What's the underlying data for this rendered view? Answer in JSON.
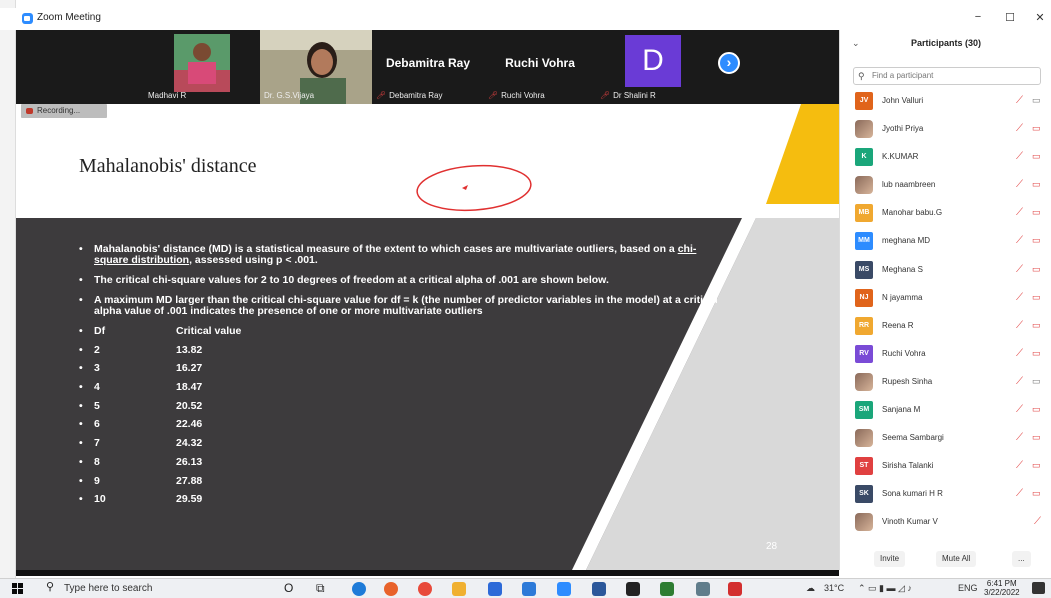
{
  "window": {
    "title": "Zoom Meeting",
    "minimize": "−",
    "maximize": "☐",
    "close": "✕"
  },
  "video_strip": {
    "tiles": [
      {
        "name": "Madhavi R"
      },
      {
        "name": "Dr. G.S.Vijaya"
      },
      {
        "big_name": "Debamitra Ray",
        "name": "Debamitra Ray"
      },
      {
        "big_name": "Ruchi Vohra",
        "name": "Ruchi Vohra"
      },
      {
        "letter": "D",
        "name": "Dr Shalini R"
      }
    ],
    "next_arrow": "›"
  },
  "recording": {
    "label": "Recording..."
  },
  "slide": {
    "title": "Mahalanobis' distance",
    "bullet1_pre": "Mahalanobis' distance (MD) is a statistical measure of the extent to which cases are multivariate outliers, based on a ",
    "bullet1_link": "chi-square distribution",
    "bullet1_post": ", assessed using p < .001.",
    "bullet2": "The critical chi-square values for 2 to 10 degrees of freedom at a critical alpha of .001 are shown below.",
    "bullet3": "A maximum MD larger than the critical chi-square value for df = k (the number of predictor variables in the model) at a critical alpha value of .001 indicates the presence of one or more multivariate outliers",
    "table_header": {
      "df": "Df",
      "value": "Critical value"
    },
    "table_rows": [
      {
        "df": "2",
        "value": "13.82"
      },
      {
        "df": "3",
        "value": "16.27"
      },
      {
        "df": "4",
        "value": "18.47"
      },
      {
        "df": "5",
        "value": "20.52"
      },
      {
        "df": "6",
        "value": "22.46"
      },
      {
        "df": "7",
        "value": "24.32"
      },
      {
        "df": "8",
        "value": "26.13"
      },
      {
        "df": "9",
        "value": "27.88"
      },
      {
        "df": "10",
        "value": "29.59"
      }
    ],
    "page_number": "28"
  },
  "participants": {
    "header": "Participants (30)",
    "search_placeholder": "Find a participant",
    "list": [
      {
        "initials": "JV",
        "color": "#e0641b",
        "name": "John Valluri",
        "cam": "on"
      },
      {
        "initials": "",
        "color": "",
        "name": "Jyothi Priya",
        "cam": "off"
      },
      {
        "initials": "K",
        "color": "#1aa67a",
        "name": "K.KUMAR",
        "cam": "off"
      },
      {
        "initials": "",
        "color": "",
        "name": "lub naambreen",
        "cam": "off"
      },
      {
        "initials": "MB",
        "color": "#f0a830",
        "name": "Manohar babu.G",
        "cam": "off"
      },
      {
        "initials": "MM",
        "color": "#2d8cff",
        "name": "meghana MD",
        "cam": "off"
      },
      {
        "initials": "MS",
        "color": "#3a4a66",
        "name": "Meghana S",
        "cam": "off"
      },
      {
        "initials": "NJ",
        "color": "#e0641b",
        "name": "N jayamma",
        "cam": "off"
      },
      {
        "initials": "RR",
        "color": "#f0a830",
        "name": "Reena R",
        "cam": "off"
      },
      {
        "initials": "RV",
        "color": "#7a4bd6",
        "name": "Ruchi Vohra",
        "cam": "off"
      },
      {
        "initials": "",
        "color": "",
        "name": "Rupesh Sinha",
        "cam": "on"
      },
      {
        "initials": "SM",
        "color": "#1aa67a",
        "name": "Sanjana M",
        "cam": "off"
      },
      {
        "initials": "",
        "color": "",
        "name": "Seema Sambargi",
        "cam": "off"
      },
      {
        "initials": "ST",
        "color": "#e04040",
        "name": "Sirisha Talanki",
        "cam": "off"
      },
      {
        "initials": "SK",
        "color": "#3a4a66",
        "name": "Sona kumari H R",
        "cam": "off"
      },
      {
        "initials": "",
        "color": "",
        "name": "Vinoth Kumar V",
        "cam": "none"
      }
    ],
    "invite_label": "Invite",
    "mute_all_label": "Mute All",
    "more_label": "..."
  },
  "taskbar": {
    "search_text": "Type here to search",
    "weather": "31°C",
    "lang": "ENG",
    "time": "6:41 PM",
    "date": "3/22/2022"
  },
  "colors": {
    "accent": "#2d8cff",
    "slide_dark": "#3d3b3d",
    "slide_yellow": "#f5bd0f"
  }
}
